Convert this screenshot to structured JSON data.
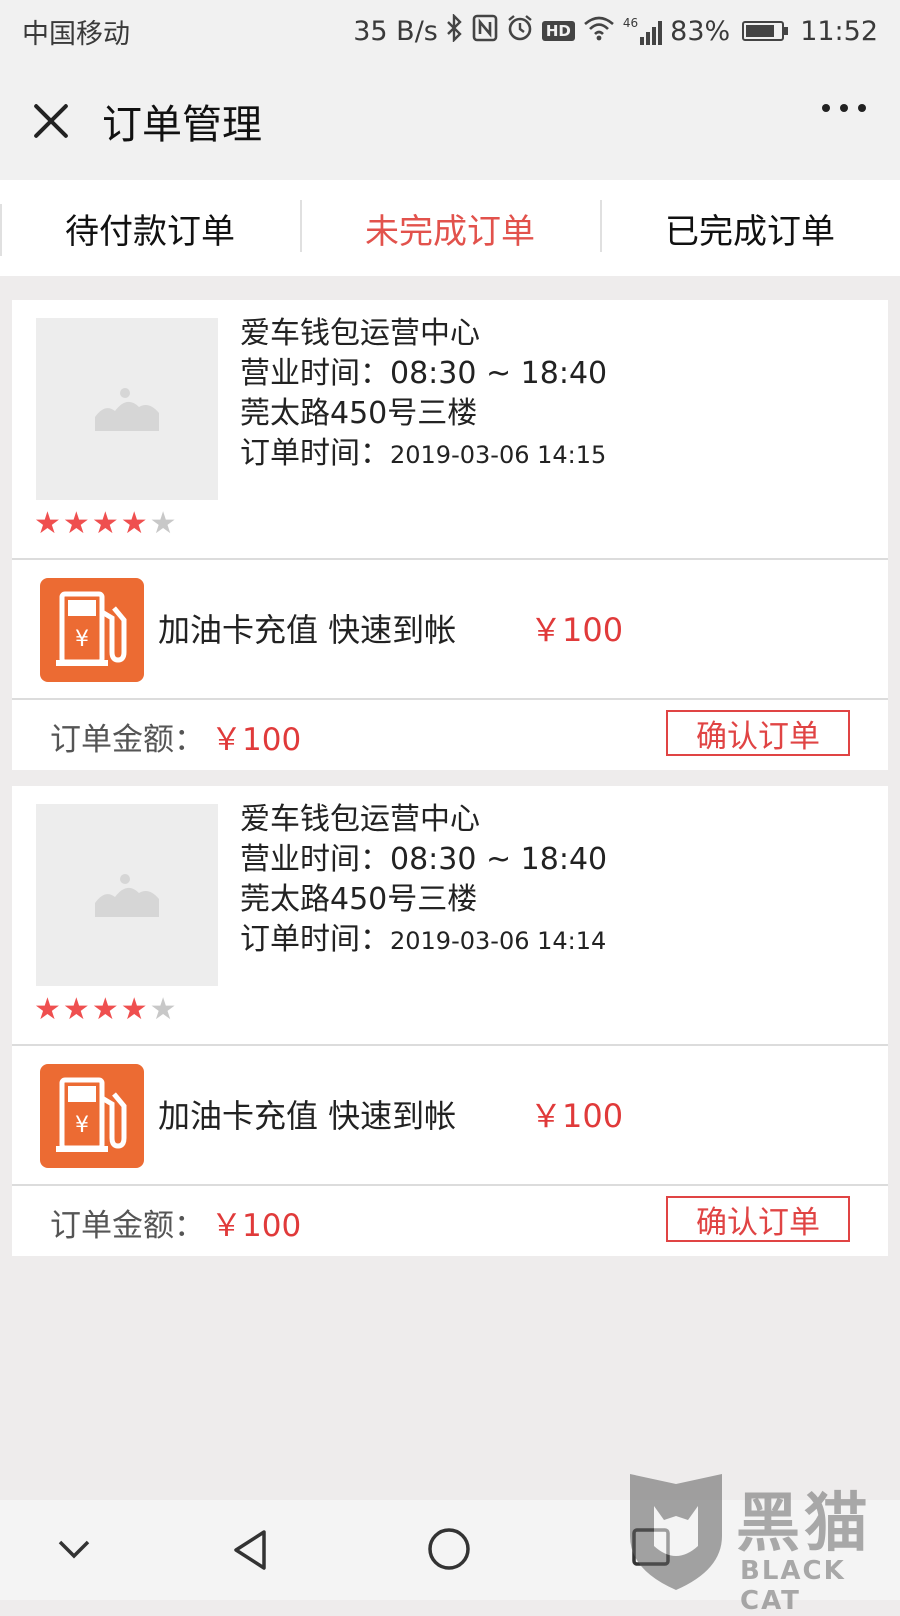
{
  "status_bar": {
    "carrier": "中国移动",
    "speed": "35 B/s",
    "network": "46",
    "battery": "83%",
    "battery_level": 0.83,
    "time": "11:52",
    "hd_label": "HD"
  },
  "header": {
    "title": "订单管理"
  },
  "tabs": [
    {
      "label": "待付款订单",
      "active": false
    },
    {
      "label": "未完成订单",
      "active": true
    },
    {
      "label": "已完成订单",
      "active": false
    }
  ],
  "orders": [
    {
      "shop_name": "爱车钱包运营中心",
      "hours_label": "营业时间：",
      "hours": "08:30 ~ 18:40",
      "address": "莞太路450号三楼",
      "order_time_label": "订单时间：",
      "order_time": "2019-03-06 14:15",
      "rating": 4,
      "rating_max": 5,
      "product_name": "加油卡充值 快速到帐",
      "product_price": "￥100",
      "amount_label": "订单金额：",
      "amount": "￥100",
      "confirm_label": "确认订单"
    },
    {
      "shop_name": "爱车钱包运营中心",
      "hours_label": "营业时间：",
      "hours": "08:30 ~ 18:40",
      "address": "莞太路450号三楼",
      "order_time_label": "订单时间：",
      "order_time": "2019-03-06 14:14",
      "rating": 4,
      "rating_max": 5,
      "product_name": "加油卡充值 快速到帐",
      "product_price": "￥100",
      "amount_label": "订单金额：",
      "amount": "￥100",
      "confirm_label": "确认订单"
    }
  ],
  "watermark": {
    "title": "黑猫",
    "subtitle": "BLACK CAT"
  },
  "colors": {
    "accent": "#e2524c",
    "price": "#e03a3a",
    "fuel_icon_bg": "#ec6b33",
    "star_on": "#ef4f4f",
    "star_off": "#c8c8c8"
  }
}
